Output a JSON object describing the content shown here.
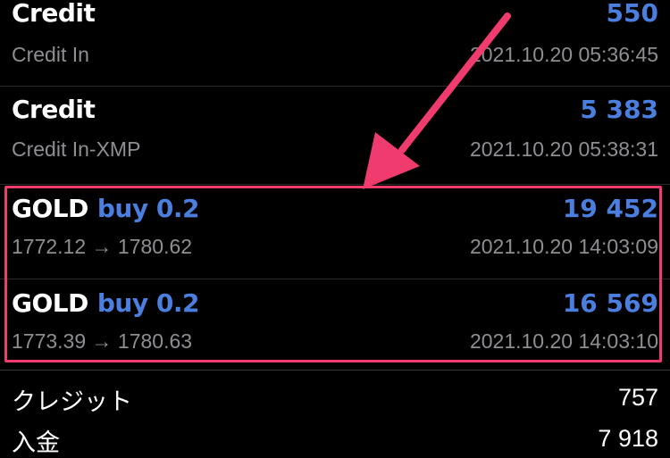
{
  "history": {
    "entries": [
      {
        "title": "Credit",
        "side": "",
        "amount": "550",
        "subtitle": "Credit In",
        "timestamp": "2021.10.20 05:36:45"
      },
      {
        "title": "Credit",
        "side": "",
        "amount": "5 383",
        "subtitle": "Credit In-XMP",
        "timestamp": "2021.10.20 05:38:31"
      },
      {
        "title": "GOLD",
        "side": "buy 0.2",
        "amount": "19 452",
        "subtitle": "1772.12 → 1780.62",
        "timestamp": "2021.10.20 14:03:09"
      },
      {
        "title": "GOLD",
        "side": "buy 0.2",
        "amount": "16 569",
        "subtitle": "1773.39 → 1780.63",
        "timestamp": "2021.10.20 14:03:10"
      }
    ]
  },
  "summary": {
    "credit_label": "クレジット",
    "credit_value": "757",
    "deposit_label": "入金",
    "deposit_value": "7 918"
  },
  "colors": {
    "amount_blue": "#4a7fe0",
    "highlight_pink": "#ef3b6e",
    "muted_gray": "#8e8e93",
    "background": "#000000"
  }
}
